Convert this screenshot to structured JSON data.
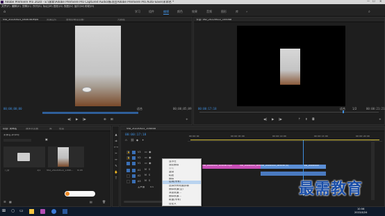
{
  "window": {
    "title": "Adobe Premiere Pro 2020 - E:\\课本\\Adobe Premiere Pro Captured Audio\\新项目Adobe Premiere Pro Auto-Save\\未命名 *"
  },
  "menubar": {
    "items": [
      "文件(F)",
      "编辑(E)",
      "剪辑(C)",
      "序列(S)",
      "标记(M)",
      "图形(G)",
      "视图(V)",
      "窗口(W)",
      "帮助(H)"
    ]
  },
  "workspaces": {
    "items": [
      "学习",
      "组件",
      "编辑",
      "颜色",
      "效果",
      "音频",
      "图形",
      "库"
    ],
    "active": "编辑"
  },
  "source": {
    "tabs": [
      "VID_20220422_083038.mp4",
      "效果控件",
      "音频剪辑混合器：",
      "元数据"
    ],
    "timecode_left": "00;00;00;00",
    "fit": "适合",
    "timecode_right": "00;00;05;09"
  },
  "program": {
    "tabs": [
      "节目: VID_20220422_104048"
    ],
    "timecode_left": "00:00:17:18",
    "fit": "适合",
    "scale": "1/2",
    "timecode_right": "00:00:21:21"
  },
  "project": {
    "tabs": [
      "项目: 未命名",
      "媒体浏览器",
      "库",
      "信息"
    ],
    "file": "未命名.prproj",
    "items": [
      {
        "name": "门片",
        "meta": "1/1"
      },
      {
        "name": "VID_20220422_1040...",
        "meta": "4:16"
      }
    ]
  },
  "timeline": {
    "tab": "VID_20220422_104048",
    "timecode": "00:00:17:18",
    "ruler": [
      "00:00:00",
      "00:00:05:00",
      "00:00:10:00",
      "00:00:15:00",
      "00:00:20:00"
    ],
    "tracks": [
      "V3",
      "V2",
      "V1",
      "A1",
      "A2",
      "A3"
    ],
    "master": "主声道",
    "master_val": "0.0",
    "clips": [
      "VID_20220422_104048.mp4",
      "VID_20220422_083038",
      "VID_20220422_083038 [V]",
      "VID_20220422"
    ]
  },
  "context_menu": {
    "items": [
      "显示在",
      "波纹删除",
      "剪切",
      "复制",
      "粘贴",
      "删除",
      "选择所有轨道剪辑",
      "删除轨道(空)",
      "启用(所有)",
      "添加轨道...",
      "删除轨道...",
      "覆盖(所有)",
      "插入",
      "自定义"
    ],
    "highlighted_index": 8
  },
  "watermark": {
    "text": "最需教育"
  },
  "taskbar": {
    "time": "10:56",
    "date": "2022/4/24"
  }
}
